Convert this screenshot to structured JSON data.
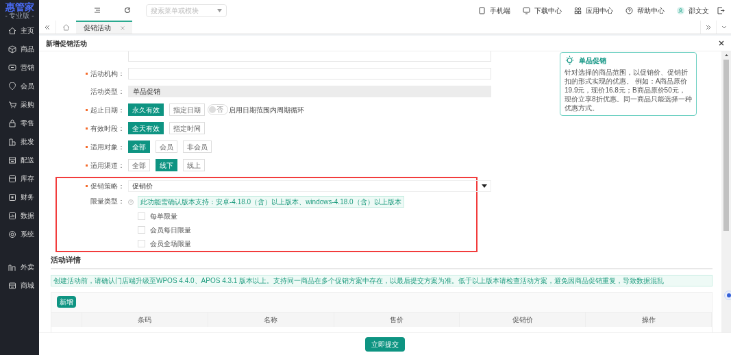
{
  "logo": {
    "name": "惠管家",
    "edition": "- 专业版 -"
  },
  "sidebar": {
    "items": [
      {
        "label": "主页"
      },
      {
        "label": "商品"
      },
      {
        "label": "营销"
      },
      {
        "label": "会员"
      },
      {
        "label": "采购"
      },
      {
        "label": "零售"
      },
      {
        "label": "批发"
      },
      {
        "label": "配送"
      },
      {
        "label": "库存"
      },
      {
        "label": "财务"
      },
      {
        "label": "数据"
      },
      {
        "label": "系统"
      }
    ],
    "extra_items": [
      {
        "label": "外卖"
      },
      {
        "label": "商城"
      }
    ]
  },
  "topbar": {
    "search": {
      "placeholder": "搜索菜单或模块"
    },
    "links": [
      {
        "label": "手机端"
      },
      {
        "label": "下载中心"
      },
      {
        "label": "应用中心"
      },
      {
        "label": "帮助中心"
      },
      {
        "label": "邵文文"
      }
    ]
  },
  "tabs": [
    {
      "label": "促销活动",
      "selected": true
    }
  ],
  "modal": {
    "title": "新增促销活动",
    "form": {
      "rows": [
        {
          "kind": "input",
          "required": false
        },
        {
          "kind": "input",
          "required": true,
          "label": "活动机构："
        },
        {
          "kind": "readonly",
          "required": false,
          "label": "活动类型：",
          "value": "单品促销"
        },
        {
          "kind": "options",
          "required": true,
          "label": "起止日期：",
          "options": [
            {
              "label": "永久有效",
              "selected": true
            },
            {
              "label": "指定日期",
              "selected": false
            }
          ],
          "toggle": {
            "on": false,
            "label": "否"
          },
          "toggle_text": "启用日期范围内周期循环"
        },
        {
          "kind": "options",
          "required": true,
          "label": "有效时段：",
          "options": [
            {
              "label": "全天有效",
              "selected": true
            },
            {
              "label": "指定时间",
              "selected": false
            }
          ]
        },
        {
          "kind": "options",
          "required": true,
          "label": "适用对象：",
          "options": [
            {
              "label": "全部",
              "selected": true
            },
            {
              "label": "会员",
              "selected": false
            },
            {
              "label": "非会员",
              "selected": false
            }
          ]
        },
        {
          "kind": "options",
          "required": true,
          "label": "适用渠道：",
          "options": [
            {
              "label": "全部",
              "selected": false
            },
            {
              "label": "线下",
              "selected": true
            },
            {
              "label": "线上",
              "selected": false
            }
          ]
        }
      ],
      "highlight_rows": [
        {
          "kind": "select",
          "required": true,
          "label": "促销策略：",
          "value": "促销价"
        },
        {
          "kind": "checkboxes",
          "required": false,
          "label": "限量类型：",
          "note": "此功能需确认版本支持：安卓-4.18.0（含）以上版本、windows-4.18.0（含）以上版本",
          "options": [
            {
              "label": "每单限量",
              "checked": false
            },
            {
              "label": "会员每日限量",
              "checked": false
            },
            {
              "label": "会员全场限量",
              "checked": false
            }
          ]
        }
      ]
    },
    "tip": {
      "title": "单品促销",
      "text": "针对选择的商品范围，以促销价、促销折扣的形式实现的优惠。 例如：A商品原价19.9元，现价16.8元；B商品原价50元，现价立享8折优惠。同一商品只能选择一种优惠方式。"
    },
    "details": {
      "title": "活动详情",
      "notice": "创建活动前，请确认门店端升级至WPOS 4.4.0、APOS 4.3.1 版本以上。支持同一商品在多个促销方案中存在，以最后提交方案为准。低于以上版本请检查活动方案，避免因商品促销重复，导致数据混乱",
      "add_button": "新增",
      "columns": [
        "条码",
        "名称",
        "售价",
        "促销价",
        "操作"
      ]
    },
    "submit": "立即提交"
  }
}
